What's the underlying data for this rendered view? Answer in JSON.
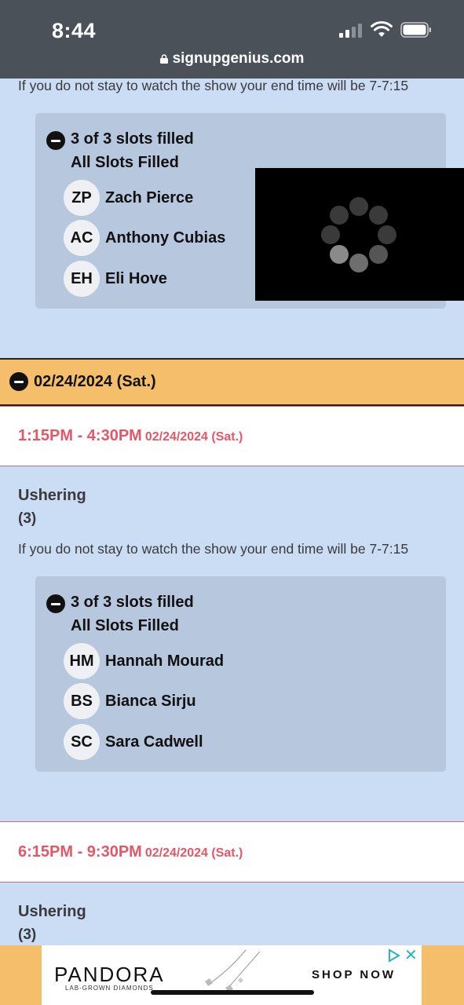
{
  "status_bar": {
    "time": "8:44",
    "url": "signupgenius.com"
  },
  "note_text": "If you do not stay to watch the show your end time will be 7-7:15",
  "first_block": {
    "filled": "3 of 3 slots filled",
    "all_filled": "All Slots Filled",
    "people": [
      {
        "initials": "ZP",
        "name": "Zach Pierce"
      },
      {
        "initials": "AC",
        "name": "Anthony Cubias"
      },
      {
        "initials": "EH",
        "name": "Eli Hove"
      }
    ]
  },
  "date_header": "02/24/2024 (Sat.)",
  "slot1": {
    "time": "1:15PM - 4:30PM",
    "date": "02/24/2024 (Sat.)",
    "role": "Ushering",
    "count": "(3)",
    "note": "If you do not stay to watch the show your end time will be 7-7:15",
    "filled": "3 of 3 slots filled",
    "all_filled": "All Slots Filled",
    "people": [
      {
        "initials": "HM",
        "name": "Hannah Mourad"
      },
      {
        "initials": "BS",
        "name": "Bianca Sirju"
      },
      {
        "initials": "SC",
        "name": "Sara Cadwell"
      }
    ]
  },
  "slot2": {
    "time": "6:15PM - 9:30PM",
    "date": "02/24/2024 (Sat.)",
    "role": "Ushering",
    "count": "(3)"
  },
  "ad": {
    "logo": "PANDORA",
    "subtitle": "LAB-GROWN DIAMONDS",
    "cta": "SHOP NOW",
    "close": "✕"
  },
  "colors": {
    "accent_red": "#e45766",
    "date_band": "#f4be6b",
    "page_bg": "#cbdcf5"
  },
  "icons": [
    "lock-icon",
    "signal-icon",
    "wifi-icon",
    "battery-icon",
    "minus-circle-icon",
    "loading-spinner-icon",
    "ad-choices-icon",
    "close-icon"
  ]
}
